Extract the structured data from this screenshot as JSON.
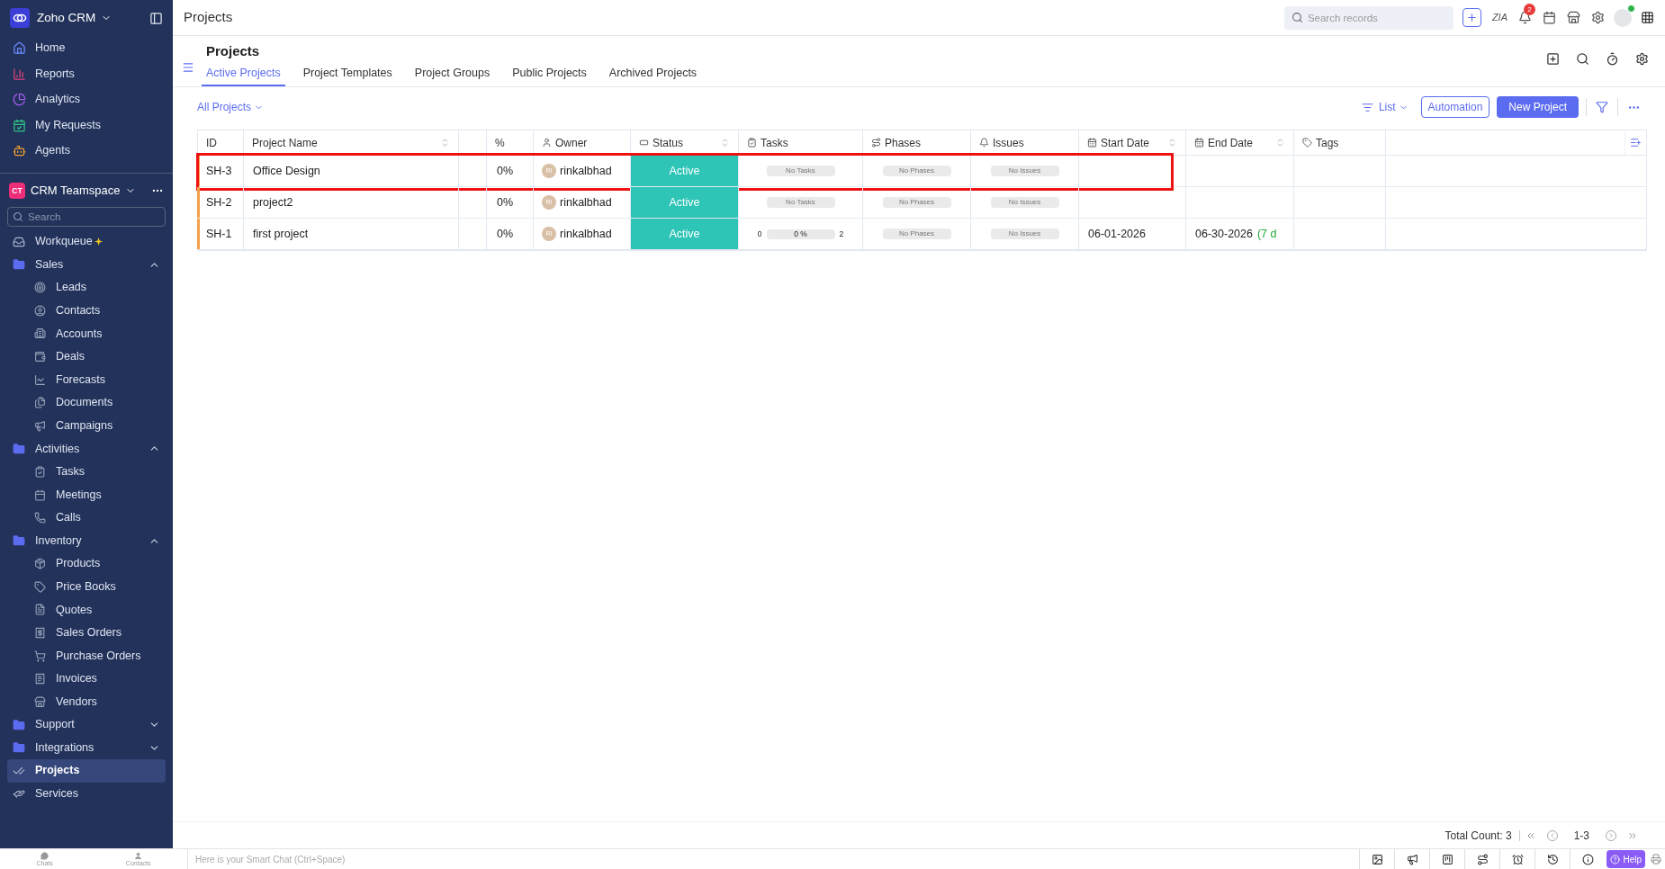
{
  "sidebar": {
    "app_name": "Zoho CRM",
    "nav": [
      {
        "label": "Home",
        "selected": false
      },
      {
        "label": "Reports",
        "selected": false
      },
      {
        "label": "Analytics",
        "selected": false
      },
      {
        "label": "My Requests",
        "selected": false
      },
      {
        "label": "Agents",
        "selected": false
      }
    ],
    "teamspace": {
      "badge": "CT",
      "name": "CRM Teamspace",
      "search_placeholder": "Search"
    },
    "items": [
      {
        "label": "Workqueue",
        "selected": false
      },
      {
        "label": "Sales",
        "selected": false,
        "expanded": true,
        "children": [
          {
            "label": "Leads",
            "selected": false
          },
          {
            "label": "Contacts",
            "selected": false
          },
          {
            "label": "Accounts",
            "selected": false
          },
          {
            "label": "Deals",
            "selected": false
          },
          {
            "label": "Forecasts",
            "selected": false
          },
          {
            "label": "Documents",
            "selected": false
          },
          {
            "label": "Campaigns",
            "selected": false
          }
        ]
      },
      {
        "label": "Activities",
        "selected": false,
        "expanded": true,
        "children": [
          {
            "label": "Tasks",
            "selected": false
          },
          {
            "label": "Meetings",
            "selected": false
          },
          {
            "label": "Calls",
            "selected": false
          }
        ]
      },
      {
        "label": "Inventory",
        "selected": false,
        "expanded": true,
        "children": [
          {
            "label": "Products",
            "selected": false
          },
          {
            "label": "Price Books",
            "selected": false
          },
          {
            "label": "Quotes",
            "selected": false
          },
          {
            "label": "Sales Orders",
            "selected": false
          },
          {
            "label": "Purchase Orders",
            "selected": false
          },
          {
            "label": "Invoices",
            "selected": false
          },
          {
            "label": "Vendors",
            "selected": false
          }
        ]
      },
      {
        "label": "Support",
        "selected": false,
        "expanded": false
      },
      {
        "label": "Integrations",
        "selected": false,
        "expanded": false
      },
      {
        "label": "Projects",
        "selected": true
      },
      {
        "label": "Services",
        "selected": false
      }
    ],
    "bottom": [
      "Chats",
      "Contacts"
    ]
  },
  "top_bar": {
    "title": "Projects",
    "search_placeholder": "Search records",
    "zia_label": "ZIA",
    "notification_count": "2"
  },
  "page": {
    "title": "Projects",
    "tabs": [
      {
        "label": "Active Projects",
        "selected": true
      },
      {
        "label": "Project Templates",
        "selected": false
      },
      {
        "label": "Project Groups",
        "selected": false
      },
      {
        "label": "Public Projects",
        "selected": false
      },
      {
        "label": "Archived Projects",
        "selected": false
      }
    ],
    "view_filter": "All Projects",
    "view_mode": "List",
    "buttons": [
      "Automation",
      "New Project"
    ]
  },
  "table": {
    "columns": [
      "ID",
      "Project Name",
      "",
      "%",
      "Owner",
      "Status",
      "Tasks",
      "Phases",
      "Issues",
      "Start Date",
      "End Date",
      "Tags"
    ],
    "rows": [
      {
        "id": "SH-3",
        "name": "Office Design",
        "percent": "0%",
        "owner_initials": "RI",
        "owner": "rinkalbhad",
        "status": "Active",
        "tasks": {
          "kind": "empty",
          "label": "No Tasks"
        },
        "phases": "No Phases",
        "issues": "No Issues",
        "highlighted": true,
        "color": "#f5a04a"
      },
      {
        "id": "SH-2",
        "name": "project2",
        "percent": "0%",
        "owner_initials": "RI",
        "owner": "rinkalbhad",
        "status": "Active",
        "tasks": {
          "kind": "empty",
          "label": "No Tasks"
        },
        "phases": "No Phases",
        "issues": "No Issues",
        "highlighted": false,
        "color": "#f5a04a"
      },
      {
        "id": "SH-1",
        "name": "first project",
        "percent": "0%",
        "owner_initials": "RI",
        "owner": "rinkalbhad",
        "status": "Active",
        "tasks": {
          "kind": "progress",
          "start": "0",
          "level": 0,
          "reading": "0 %",
          "end": "2"
        },
        "phases": "No Phases",
        "issues": "No Issues",
        "start_date": "06-01-2026",
        "end_date": "06-30-2026",
        "duration": "(7 d",
        "highlighted": false,
        "color": "#f5a04a"
      }
    ]
  },
  "footer": {
    "total": "Total Count: 3",
    "range": "1-3"
  },
  "chat_bar": {
    "placeholder": "Here is your Smart Chat (Ctrl+Space)",
    "help": "Help"
  }
}
